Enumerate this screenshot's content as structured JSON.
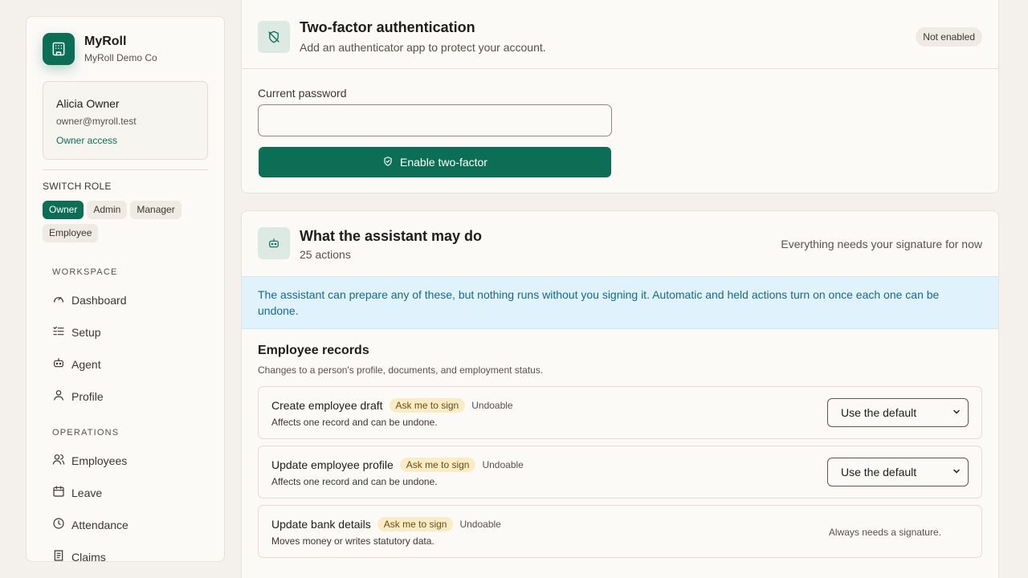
{
  "brand": {
    "name": "MyRoll",
    "company": "MyRoll Demo Co"
  },
  "user": {
    "name": "Alicia Owner",
    "email": "owner@myroll.test",
    "access": "Owner access"
  },
  "switch_role": {
    "label": "SWITCH ROLE",
    "roles": [
      "Owner",
      "Admin",
      "Manager",
      "Employee"
    ],
    "active": "Owner"
  },
  "nav": {
    "workspace_label": "WORKSPACE",
    "workspace": [
      {
        "label": "Dashboard",
        "icon": "gauge-icon"
      },
      {
        "label": "Setup",
        "icon": "checklist-icon"
      },
      {
        "label": "Agent",
        "icon": "robot-icon"
      },
      {
        "label": "Profile",
        "icon": "user-icon"
      }
    ],
    "operations_label": "OPERATIONS",
    "operations": [
      {
        "label": "Employees",
        "icon": "users-icon"
      },
      {
        "label": "Leave",
        "icon": "calendar-icon"
      },
      {
        "label": "Attendance",
        "icon": "clock-icon"
      },
      {
        "label": "Claims",
        "icon": "receipt-icon"
      }
    ]
  },
  "two_factor": {
    "title": "Two-factor authentication",
    "subtitle": "Add an authenticator app to protect your account.",
    "status": "Not enabled",
    "password_label": "Current password",
    "password_value": "",
    "button_label": "Enable two-factor"
  },
  "assistant": {
    "title": "What the assistant may do",
    "count": "25 actions",
    "right_note": "Everything needs your signature for now",
    "notice": "The assistant can prepare any of these, but nothing runs without you signing it. Automatic and held actions turn on once each one can be undone.",
    "section_title": "Employee records",
    "section_sub": "Changes to a person's profile, documents, and employment status.",
    "actions": [
      {
        "name": "Create employee draft",
        "badge": "Ask me to sign",
        "undo": "Undoable",
        "desc": "Affects one record and can be undone.",
        "select": "Use the default"
      },
      {
        "name": "Update employee profile",
        "badge": "Ask me to sign",
        "undo": "Undoable",
        "desc": "Affects one record and can be undone.",
        "select": "Use the default"
      },
      {
        "name": "Update bank details",
        "badge": "Ask me to sign",
        "undo": "Undoable",
        "desc": "Moves money or writes statutory data.",
        "note": "Always needs a signature."
      }
    ]
  },
  "colors": {
    "accent": "#0b6e55",
    "background": "#f4f1ec",
    "notice_bg": "#e0f2fb",
    "badge_sign": "#fbecc8"
  }
}
